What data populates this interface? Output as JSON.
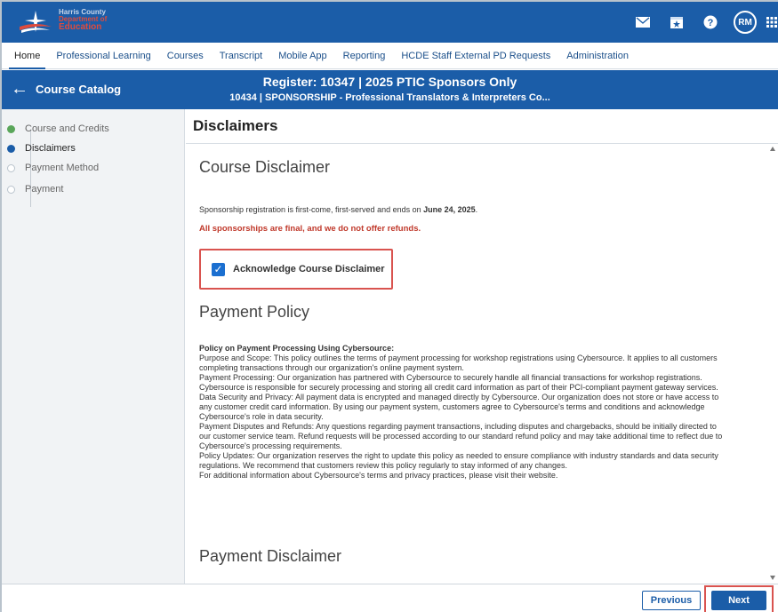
{
  "app": {
    "org_line1": "Harris County",
    "org_line2": "Department of",
    "org_line3": "Education"
  },
  "topbar": {
    "avatar_initials": "RM"
  },
  "nav": {
    "items": [
      "Home",
      "Professional Learning",
      "Courses",
      "Transcript",
      "Mobile App",
      "Reporting",
      "HCDE Staff External PD Requests",
      "Administration"
    ],
    "active": "Home"
  },
  "titlebar": {
    "back_label": "Course Catalog",
    "title": "Register: 10347 | 2025 PTIC Sponsors Only",
    "subtitle": "10434 | SPONSORSHIP - Professional Translators & Interpreters Co..."
  },
  "steps": [
    {
      "label": "Course and Credits",
      "state": "done"
    },
    {
      "label": "Disclaimers",
      "state": "current"
    },
    {
      "label": "Payment Method",
      "state": "pending"
    },
    {
      "label": "Payment",
      "state": "pending"
    }
  ],
  "main": {
    "heading": "Disclaimers",
    "course_disclaimer_title": "Course Disclaimer",
    "course_disclaimer_text_before": "Sponsorship registration is first-come, first-served and ends on ",
    "course_disclaimer_date": "June 24, 2025",
    "course_disclaimer_text_after": ".",
    "refund_warning": "All sponsorships are final, and we do not offer refunds.",
    "acknowledge_label": "Acknowledge Course Disclaimer",
    "acknowledge_checked": true,
    "payment_policy_title": "Payment Policy",
    "policy_heading": "Policy on Payment Processing Using Cybersource:",
    "policy_lines": [
      "Purpose and Scope: This policy outlines the terms of payment processing for workshop registrations using Cybersource. It applies to all customers",
      "completing transactions through our organization's online payment system.",
      "Payment Processing: Our organization has partnered with Cybersource to securely handle all financial transactions for workshop registrations.",
      "Cybersource is responsible for securely processing and storing all credit card information as part of their PCI-compliant payment gateway services.",
      "Data Security and Privacy: All payment data is encrypted and managed directly by Cybersource. Our organization does not store or have access to",
      "any customer credit card information. By using our payment system, customers agree to Cybersource's terms and conditions and acknowledge",
      "Cybersource's role in data security.",
      "Payment Disputes and Refunds: Any questions regarding payment transactions, including disputes and chargebacks, should be initially directed to",
      "our customer service team. Refund requests will be processed according to our standard refund policy and may take additional time to reflect due to",
      "Cybersource's processing requirements.",
      "Policy Updates: Our organization reserves the right to update this policy as needed to ensure compliance with industry standards and data security",
      "regulations. We recommend that customers review this policy regularly to stay informed of any changes.",
      "For additional information about Cybersource's terms and privacy practices, please visit their website."
    ],
    "payment_disclaimer_title": "Payment Disclaimer"
  },
  "footer": {
    "previous_label": "Previous",
    "next_label": "Next"
  },
  "colors": {
    "brand_blue": "#1b5da8",
    "highlight_red": "#d9534f",
    "warning_red": "#c0392b",
    "done_green": "#5aa65a"
  }
}
